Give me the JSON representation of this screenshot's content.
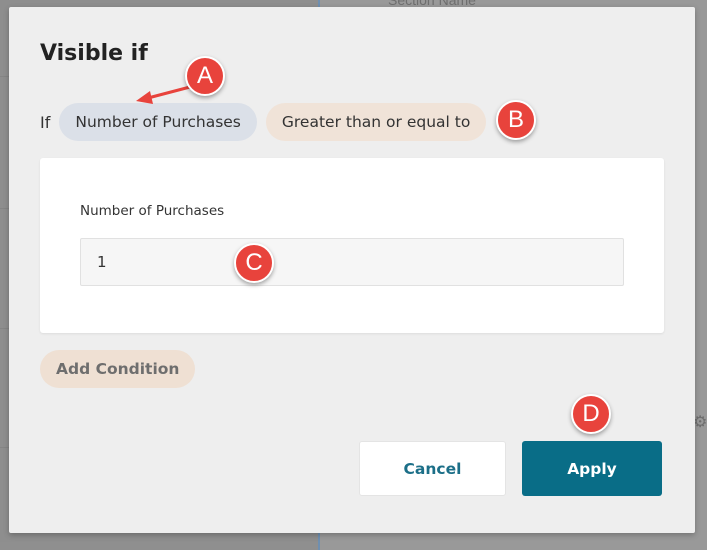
{
  "background": {
    "section_title": "Section Name"
  },
  "dialog": {
    "title": "Visible if",
    "if_label": "If",
    "field_pill": "Number of Purchases",
    "operator_pill": "Greater than or equal to",
    "value_label": "Number of Purchases",
    "value": "1",
    "add_condition": "Add Condition",
    "cancel": "Cancel",
    "apply": "Apply"
  },
  "callouts": {
    "a": "A",
    "b": "B",
    "c": "C",
    "d": "D"
  },
  "colors": {
    "apply_button": "#096d87",
    "callout": "#e8433c",
    "field_pill": "#dbe0e8",
    "operator_pill": "#f0e3d8"
  }
}
